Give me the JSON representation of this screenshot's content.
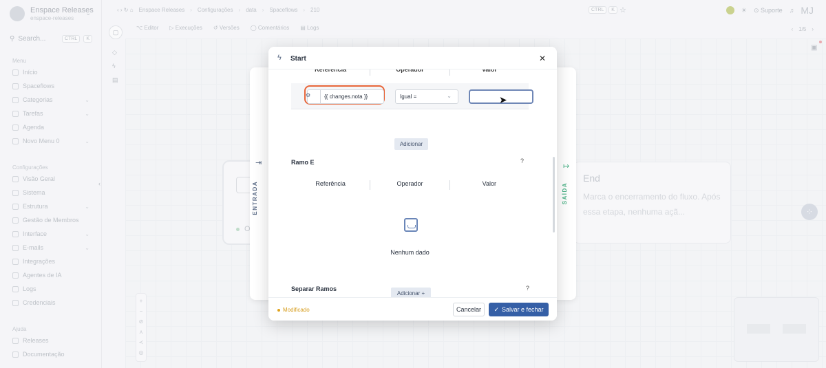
{
  "org": {
    "name": "Enspace Releases",
    "slug": "enspace-releases"
  },
  "search": {
    "label": "Search...",
    "kbd1": "CTRL",
    "kbd2": "K"
  },
  "sidebar": {
    "menu_label": "Menu",
    "menu_items": [
      {
        "label": "Início"
      },
      {
        "label": "Spaceflows"
      },
      {
        "label": "Categorias"
      },
      {
        "label": "Tarefas"
      },
      {
        "label": "Agenda"
      },
      {
        "label": "Novo Menu 0"
      }
    ],
    "config_label": "Configurações",
    "config_items": [
      {
        "label": "Visão Geral"
      },
      {
        "label": "Sistema"
      },
      {
        "label": "Estrutura"
      },
      {
        "label": "Gestão de Membros"
      },
      {
        "label": "Interface"
      },
      {
        "label": "E-mails"
      },
      {
        "label": "Integrações"
      },
      {
        "label": "Agentes de IA"
      },
      {
        "label": "Logs"
      },
      {
        "label": "Credenciais"
      }
    ],
    "help_label": "Ajuda",
    "help_items": [
      {
        "label": "Releases"
      },
      {
        "label": "Documentação"
      }
    ]
  },
  "breadcrumb": [
    "Enspace Releases",
    "Configurações",
    "data",
    "Spaceflows",
    "210"
  ],
  "topbar": {
    "ctrl": "CTRL",
    "k": "K",
    "support": "Suporte",
    "initials": "MJ"
  },
  "toolbar": {
    "editor": "Editor",
    "runs": "Execuções",
    "versions": "Versões",
    "comments": "Comentários",
    "logs": "Logs",
    "pager": "1/5"
  },
  "end_node": {
    "title": "End",
    "description": "Marca o encerramento do fluxo. Após essa etapa, nenhuma açã..."
  },
  "left_node": {
    "label": "O"
  },
  "panel": {
    "entrada": "ENTRADA",
    "saida": "SAÍDA"
  },
  "modal": {
    "title": "Start",
    "table_headers": [
      "Referência",
      "Operador",
      "Valor"
    ],
    "condition": {
      "reference": "{{ changes.nota }}",
      "operator": "Igual =",
      "value": ""
    },
    "add_label": "Adicionar",
    "branch_e": {
      "title": "Ramo E",
      "headers": [
        "Referência",
        "Operador",
        "Valor"
      ],
      "empty_text": "Nenhum dado",
      "add_label": "Adicionar +"
    },
    "split_title": "Separar Ramos",
    "footer": {
      "modified": "Modificado",
      "cancel": "Cancelar",
      "save": "Salvar e fechar"
    }
  }
}
